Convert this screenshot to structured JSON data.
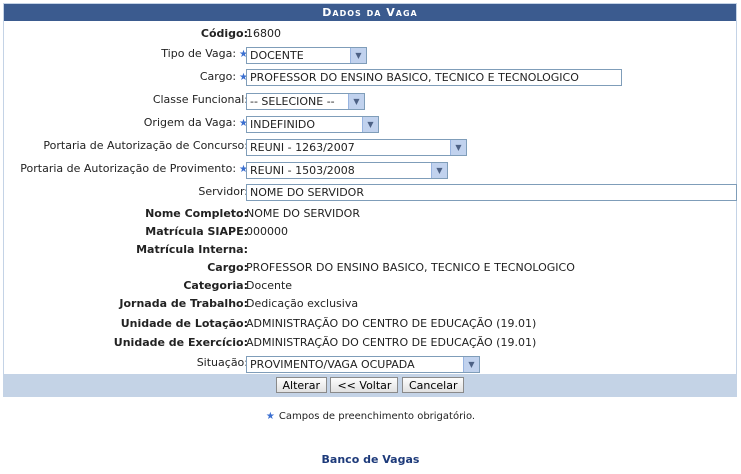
{
  "caption": "Dados da Vaga",
  "form": {
    "codigo_label": "Código:",
    "codigo_value": "16800",
    "tipo_label": "Tipo de Vaga:",
    "tipo_value": "DOCENTE",
    "cargo_label": "Cargo:",
    "cargo_value": "PROFESSOR DO ENSINO BASICO, TECNICO E TECNOLOGICO",
    "classe_label": "Classe Funcional:",
    "classe_value": "-- SELECIONE --",
    "origem_label": "Origem da Vaga:",
    "origem_value": "INDEFINIDO",
    "portaria_concurso_label": "Portaria de Autorização de Concurso:",
    "portaria_concurso_value": "REUNI - 1263/2007",
    "portaria_provimento_label": "Portaria de Autorização de Provimento:",
    "portaria_provimento_value": "REUNI - 1503/2008",
    "servidor_label": "Servidor:",
    "servidor_value": "NOME DO SERVIDOR",
    "nome_label": "Nome Completo:",
    "nome_value": "NOME DO SERVIDOR",
    "siape_label": "Matrícula SIAPE:",
    "siape_value": "000000",
    "interna_label": "Matrícula Interna:",
    "interna_value": "",
    "cargo2_label": "Cargo:",
    "cargo2_value": "PROFESSOR DO ENSINO BASICO, TECNICO E TECNOLOGICO",
    "categoria_label": "Categoria:",
    "categoria_value": "Docente",
    "jornada_label": "Jornada de Trabalho:",
    "jornada_value": "Dedicação exclusiva",
    "lotacao_label": "Unidade de Lotação:",
    "lotacao_value": "ADMINISTRAÇÃO DO CENTRO DE EDUCAÇÃO (19.01)",
    "exercicio_label": "Unidade de Exercício:",
    "exercicio_value": "ADMINISTRAÇÃO DO CENTRO DE EDUCAÇÃO (19.01)",
    "situacao_label": "Situação:",
    "situacao_value": "PROVIMENTO/VAGA OCUPADA"
  },
  "buttons": {
    "alterar": "Alterar",
    "voltar": "<< Voltar",
    "cancelar": "Cancelar"
  },
  "required_glyph": "★",
  "dropdown_glyph": "▼",
  "note": "Campos de preenchimento obrigatório.",
  "link": "Banco de Vagas",
  "colors": {
    "header": "#3b5b8f",
    "footer_bar": "#c4d3e6",
    "star": "#3b6fd0",
    "link": "#1d3a7a"
  }
}
